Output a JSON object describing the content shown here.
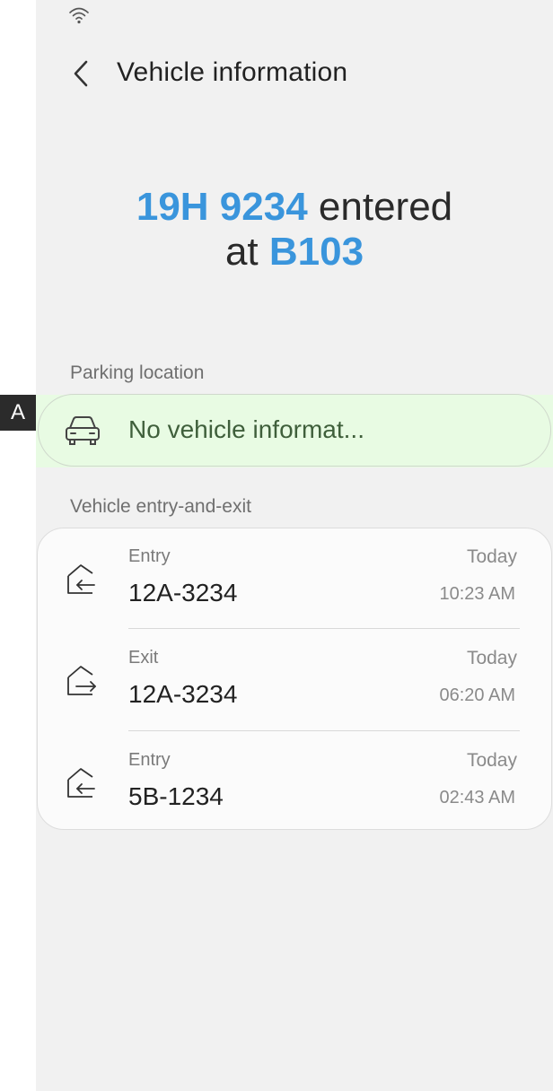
{
  "header": {
    "title": "Vehicle information"
  },
  "hero": {
    "plate": "19H 9234",
    "entered_text": "entered",
    "at_text": "at",
    "location": "B103"
  },
  "parking": {
    "section_label": "Parking location",
    "status_text": "No vehicle informat..."
  },
  "marker": {
    "label": "A"
  },
  "log": {
    "section_label": "Vehicle entry-and-exit",
    "rows": [
      {
        "type": "Entry",
        "plate": "12A-3234",
        "day": "Today",
        "time": "10:23 AM",
        "icon": "entry-icon"
      },
      {
        "type": "Exit",
        "plate": "12A-3234",
        "day": "Today",
        "time": "06:20 AM",
        "icon": "exit-icon"
      },
      {
        "type": "Entry",
        "plate": "5B-1234",
        "day": "Today",
        "time": "02:43 AM",
        "icon": "entry-icon"
      }
    ]
  },
  "colors": {
    "accent": "#3a95dc",
    "highlight": "#e8fbe3",
    "background": "#f1f1f1"
  }
}
